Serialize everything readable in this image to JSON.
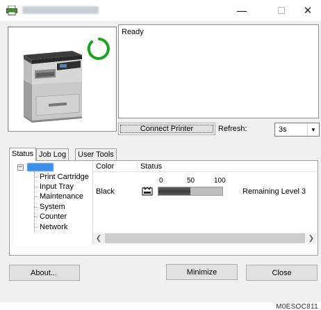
{
  "window": {
    "title": "",
    "minimize_glyph": "—",
    "close_glyph": "✕"
  },
  "printer": {
    "status_text": "Ready",
    "ready_indicator_color": "#19a31e"
  },
  "controls": {
    "connect_label": "Connect Printer",
    "refresh_label": "Refresh:",
    "refresh_value": "3s"
  },
  "tabs": [
    {
      "label": "Status",
      "active": true
    },
    {
      "label": "Job Log",
      "active": false
    },
    {
      "label": "User Tools",
      "active": false
    }
  ],
  "tree": {
    "root_label": "",
    "items": [
      "Print Cartridge",
      "Input Tray",
      "Maintenance",
      "System",
      "Counter",
      "Network"
    ]
  },
  "list": {
    "headers": {
      "color": "Color",
      "status": "Status"
    },
    "scale": [
      "0",
      "50",
      "100"
    ],
    "rows": [
      {
        "color": "Black",
        "level_percent": 50,
        "remaining": "Remaining Level 3"
      }
    ]
  },
  "buttons": {
    "about": "About...",
    "minimize": "Minimize",
    "close": "Close"
  },
  "figure_code": "M0ESOC811"
}
